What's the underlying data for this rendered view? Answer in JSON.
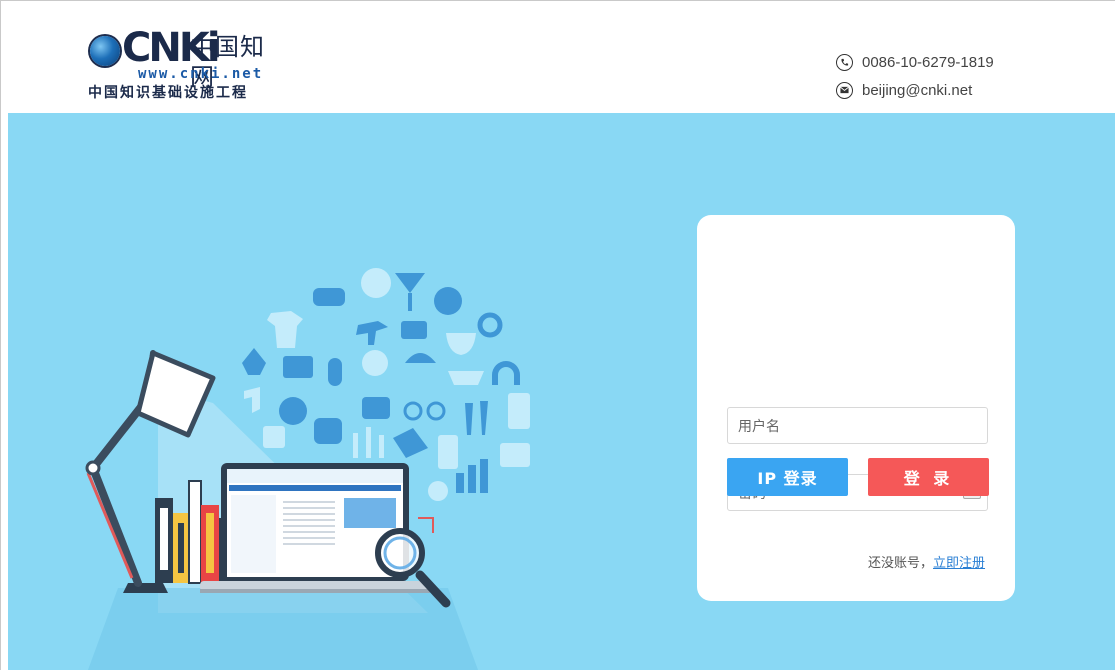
{
  "brand": {
    "logo_mark": "CNKi",
    "logo_chinese": "中国知网",
    "website": "www.cnki.net",
    "slogan": "中国知识基础设施工程"
  },
  "contact": {
    "phone": "0086-10-6279-1819",
    "phone_icon": "phone-icon",
    "email": "beijing@cnki.net",
    "email_icon": "mail-icon"
  },
  "login": {
    "username_placeholder": "用户名",
    "password_placeholder": "密码",
    "keyboard_icon": "keyboard-icon",
    "ip_login_label": "IP 登录",
    "login_label": "登 录",
    "no_account_text": "还没账号，",
    "register_link": "立即注册"
  },
  "colors": {
    "banner_bg": "#89d8f4",
    "ip_button": "#3aa5f2",
    "login_button": "#f55858",
    "link": "#2a7fd4"
  }
}
